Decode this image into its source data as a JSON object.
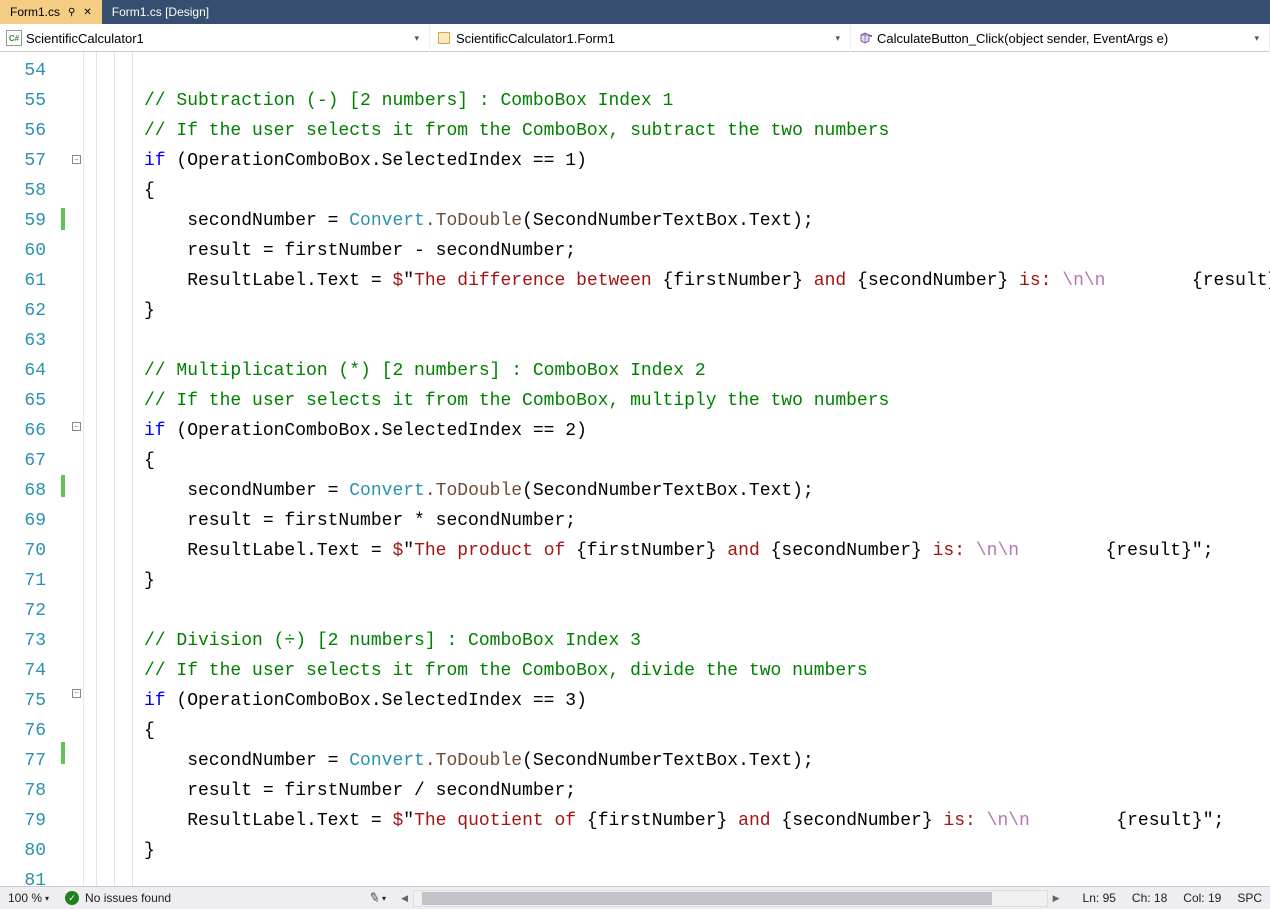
{
  "tabs": {
    "active": "Form1.cs",
    "inactive": "Form1.cs [Design]"
  },
  "nav": {
    "cell1": "ScientificCalculator1",
    "cell2": "ScientificCalculator1.Form1",
    "cell3": "CalculateButton_Click(object sender, EventArgs e)"
  },
  "cs_badge": "C#",
  "lines": {
    "start": 54,
    "end": 81,
    "greenMarks": [
      59,
      68,
      77
    ],
    "foldMinus": [
      57,
      66,
      75
    ]
  },
  "code": {
    "l55": "// Subtraction (-) [2 numbers] : ComboBox Index 1",
    "l56": "// If the user selects it from the ComboBox, subtract the two numbers",
    "l57_if": "if",
    "l57_rest": " (OperationComboBox.SelectedIndex == 1)",
    "brace_open": "{",
    "brace_close": "}",
    "assign_prefix": "    secondNumber = ",
    "convert": "Convert",
    "todouble": ".ToDouble",
    "assign_suffix": "(SecondNumberTextBox.Text);",
    "l60": "    result = firstNumber - secondNumber;",
    "resultlabel": "    ResultLabel.Text = ",
    "dollar": "$",
    "quote": "\"",
    "s61a": "The difference between ",
    "interp_open": "{",
    "interp_close": "}",
    "firstNumber": "firstNumber",
    "secondNumber": "secondNumber",
    "result": "result",
    "s_and": " and ",
    "s_is": " is: ",
    "esc": "\\n\\n",
    "pad": "        ",
    "semicolon": ";",
    "l64": "// Multiplication (*) [2 numbers] : ComboBox Index 2",
    "l65": "// If the user selects it from the ComboBox, multiply the two numbers",
    "l66_rest": " (OperationComboBox.SelectedIndex == 2)",
    "l69": "    result = firstNumber * secondNumber;",
    "s70a": "The product of ",
    "l73": "// Division (÷) [2 numbers] : ComboBox Index 3",
    "l74": "// If the user selects it from the ComboBox, divide the two numbers",
    "l75_rest": " (OperationComboBox.SelectedIndex == 3)",
    "l78": "    result = firstNumber / secondNumber;",
    "s79a": "The quotient of "
  },
  "status": {
    "zoom": "100 %",
    "issues": "No issues found",
    "ln": "Ln: 95",
    "ch": "Ch: 18",
    "col": "Col: 19",
    "spc": "SPC"
  }
}
